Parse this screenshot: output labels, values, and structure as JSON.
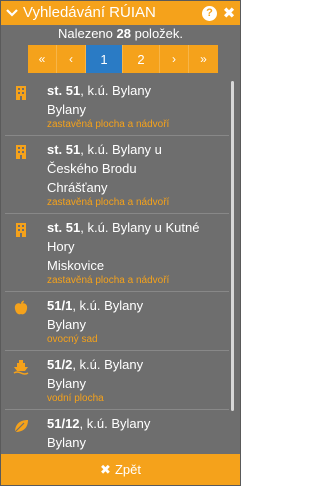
{
  "header": {
    "title": "Vyhledávání RÚIAN",
    "help_label": "?",
    "close_label": "✖"
  },
  "summary": {
    "prefix": "Nalezeno ",
    "count": "28",
    "suffix": " položek."
  },
  "pager": {
    "first": "«",
    "prev": "‹",
    "pages": [
      "1",
      "2"
    ],
    "next": "›",
    "last": "»",
    "active_page": "1"
  },
  "results": [
    {
      "icon": "building-icon",
      "bold": "st. 51",
      "rest": ", k.ú. Bylany",
      "lines": [
        "Bylany"
      ],
      "type": "zastavěná plocha a nádvoří"
    },
    {
      "icon": "building-icon",
      "bold": "st. 51",
      "rest": ", k.ú. Bylany u",
      "lines": [
        "Českého Brodu",
        "Chrášťany"
      ],
      "type": "zastavěná plocha a nádvoří"
    },
    {
      "icon": "building-icon",
      "bold": "st. 51",
      "rest": ", k.ú. Bylany u Kutné",
      "lines": [
        "Hory",
        "Miskovice"
      ],
      "type": "zastavěná plocha a nádvoří"
    },
    {
      "icon": "apple-icon",
      "bold": "51/1",
      "rest": ", k.ú. Bylany",
      "lines": [
        "Bylany"
      ],
      "type": "ovocný sad"
    },
    {
      "icon": "ship-icon",
      "bold": "51/2",
      "rest": ", k.ú. Bylany",
      "lines": [
        "Bylany"
      ],
      "type": "vodní plocha"
    },
    {
      "icon": "leaf-icon",
      "bold": "51/12",
      "rest": ", k.ú. Bylany",
      "lines": [
        "Bylany"
      ],
      "type": ""
    }
  ],
  "footer": {
    "back_icon": "✖",
    "back_label": "Zpět"
  },
  "colors": {
    "accent": "#f5a21b",
    "panel": "#6e6e6e",
    "active_page": "#2a7bc5"
  }
}
